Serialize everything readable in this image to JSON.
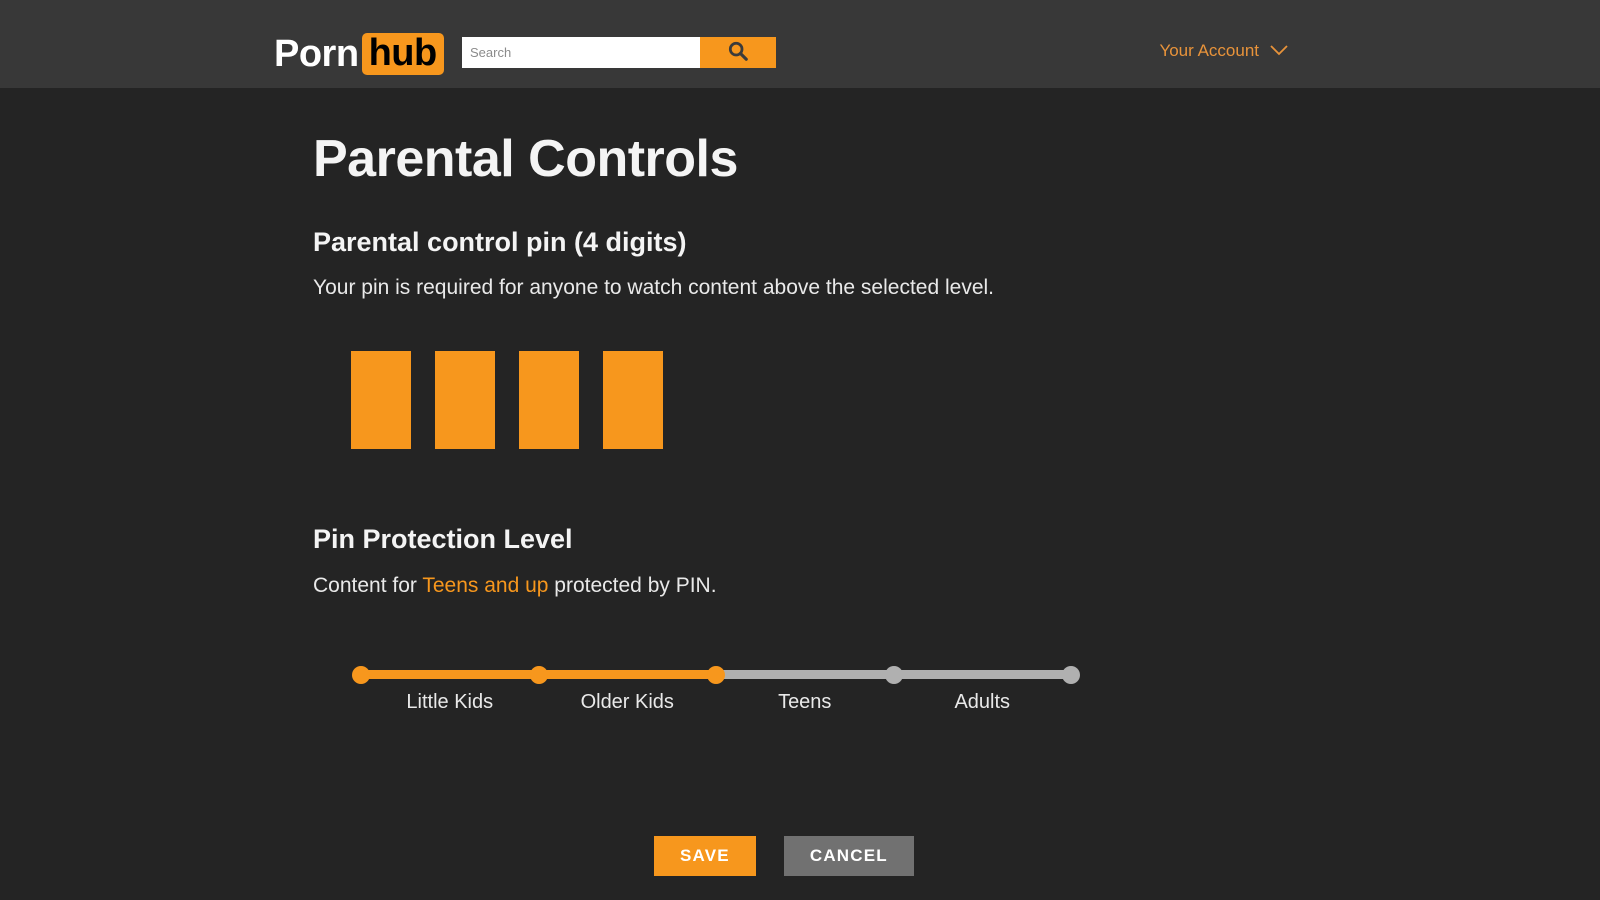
{
  "header": {
    "logo": {
      "part1": "Porn",
      "part2": "hub"
    },
    "search": {
      "placeholder": "Search",
      "value": "",
      "button_icon": "search-icon"
    },
    "account": {
      "label": "Your Account",
      "chevron_icon": "chevron-down-icon"
    },
    "background_color": "#383838"
  },
  "page": {
    "title": "Parental Controls",
    "background_color": "#242424",
    "accent_color": "#f7971d"
  },
  "pin_section": {
    "title": "Parental control pin (4 digits)",
    "description": "Your pin is required for anyone to watch content above the selected level.",
    "digits": [
      "",
      "",
      "",
      ""
    ],
    "digit_count": 4
  },
  "level_section": {
    "title": "Pin Protection Level",
    "desc_prefix": "Content for ",
    "desc_highlight": "Teens and up",
    "desc_suffix": " protected by PIN.",
    "selected_index": 2,
    "steps": [
      {
        "position_pct": 0,
        "label": "",
        "filled": true
      },
      {
        "position_pct": 25,
        "label": "Little Kids",
        "filled": true
      },
      {
        "position_pct": 50,
        "label": "Older Kids",
        "filled": true
      },
      {
        "position_pct": 75,
        "label": "Teens",
        "filled": false
      },
      {
        "position_pct": 100,
        "label": "Adults",
        "filled": false
      }
    ],
    "labels": [
      {
        "text": "Little Kids",
        "center_pct": 12.5
      },
      {
        "text": "Older Kids",
        "center_pct": 37.5
      },
      {
        "text": "Teens",
        "center_pct": 62.5
      },
      {
        "text": "Adults",
        "center_pct": 87.5
      }
    ],
    "fill_pct": 50,
    "track_color": "#b0b0b0",
    "fill_color": "#f7971d"
  },
  "actions": {
    "save_label": "SAVE",
    "cancel_label": "CANCEL",
    "save_color": "#f7971d",
    "cancel_color": "#717171"
  }
}
